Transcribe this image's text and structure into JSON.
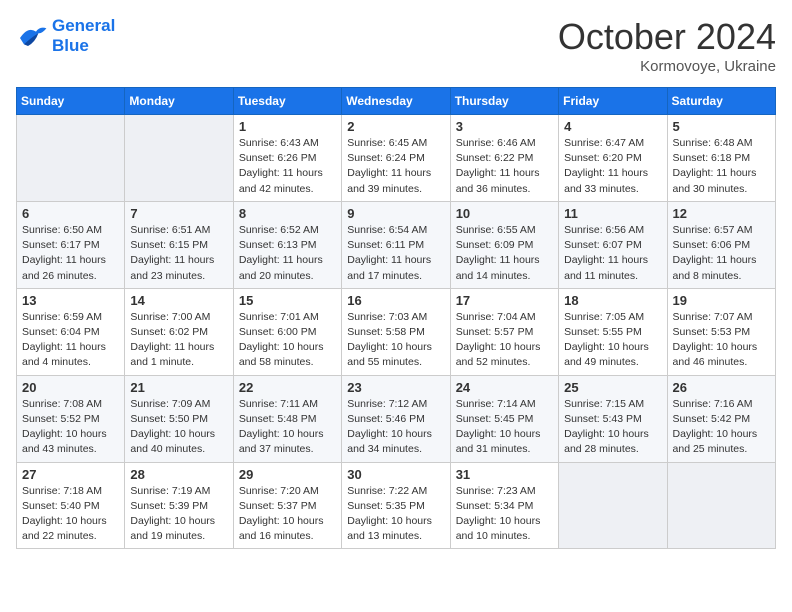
{
  "header": {
    "logo_line1": "General",
    "logo_line2": "Blue",
    "month": "October 2024",
    "location": "Kormovoye, Ukraine"
  },
  "weekdays": [
    "Sunday",
    "Monday",
    "Tuesday",
    "Wednesday",
    "Thursday",
    "Friday",
    "Saturday"
  ],
  "weeks": [
    [
      {
        "day": "",
        "sunrise": "",
        "sunset": "",
        "daylight": ""
      },
      {
        "day": "",
        "sunrise": "",
        "sunset": "",
        "daylight": ""
      },
      {
        "day": "1",
        "sunrise": "Sunrise: 6:43 AM",
        "sunset": "Sunset: 6:26 PM",
        "daylight": "Daylight: 11 hours and 42 minutes."
      },
      {
        "day": "2",
        "sunrise": "Sunrise: 6:45 AM",
        "sunset": "Sunset: 6:24 PM",
        "daylight": "Daylight: 11 hours and 39 minutes."
      },
      {
        "day": "3",
        "sunrise": "Sunrise: 6:46 AM",
        "sunset": "Sunset: 6:22 PM",
        "daylight": "Daylight: 11 hours and 36 minutes."
      },
      {
        "day": "4",
        "sunrise": "Sunrise: 6:47 AM",
        "sunset": "Sunset: 6:20 PM",
        "daylight": "Daylight: 11 hours and 33 minutes."
      },
      {
        "day": "5",
        "sunrise": "Sunrise: 6:48 AM",
        "sunset": "Sunset: 6:18 PM",
        "daylight": "Daylight: 11 hours and 30 minutes."
      }
    ],
    [
      {
        "day": "6",
        "sunrise": "Sunrise: 6:50 AM",
        "sunset": "Sunset: 6:17 PM",
        "daylight": "Daylight: 11 hours and 26 minutes."
      },
      {
        "day": "7",
        "sunrise": "Sunrise: 6:51 AM",
        "sunset": "Sunset: 6:15 PM",
        "daylight": "Daylight: 11 hours and 23 minutes."
      },
      {
        "day": "8",
        "sunrise": "Sunrise: 6:52 AM",
        "sunset": "Sunset: 6:13 PM",
        "daylight": "Daylight: 11 hours and 20 minutes."
      },
      {
        "day": "9",
        "sunrise": "Sunrise: 6:54 AM",
        "sunset": "Sunset: 6:11 PM",
        "daylight": "Daylight: 11 hours and 17 minutes."
      },
      {
        "day": "10",
        "sunrise": "Sunrise: 6:55 AM",
        "sunset": "Sunset: 6:09 PM",
        "daylight": "Daylight: 11 hours and 14 minutes."
      },
      {
        "day": "11",
        "sunrise": "Sunrise: 6:56 AM",
        "sunset": "Sunset: 6:07 PM",
        "daylight": "Daylight: 11 hours and 11 minutes."
      },
      {
        "day": "12",
        "sunrise": "Sunrise: 6:57 AM",
        "sunset": "Sunset: 6:06 PM",
        "daylight": "Daylight: 11 hours and 8 minutes."
      }
    ],
    [
      {
        "day": "13",
        "sunrise": "Sunrise: 6:59 AM",
        "sunset": "Sunset: 6:04 PM",
        "daylight": "Daylight: 11 hours and 4 minutes."
      },
      {
        "day": "14",
        "sunrise": "Sunrise: 7:00 AM",
        "sunset": "Sunset: 6:02 PM",
        "daylight": "Daylight: 11 hours and 1 minute."
      },
      {
        "day": "15",
        "sunrise": "Sunrise: 7:01 AM",
        "sunset": "Sunset: 6:00 PM",
        "daylight": "Daylight: 10 hours and 58 minutes."
      },
      {
        "day": "16",
        "sunrise": "Sunrise: 7:03 AM",
        "sunset": "Sunset: 5:58 PM",
        "daylight": "Daylight: 10 hours and 55 minutes."
      },
      {
        "day": "17",
        "sunrise": "Sunrise: 7:04 AM",
        "sunset": "Sunset: 5:57 PM",
        "daylight": "Daylight: 10 hours and 52 minutes."
      },
      {
        "day": "18",
        "sunrise": "Sunrise: 7:05 AM",
        "sunset": "Sunset: 5:55 PM",
        "daylight": "Daylight: 10 hours and 49 minutes."
      },
      {
        "day": "19",
        "sunrise": "Sunrise: 7:07 AM",
        "sunset": "Sunset: 5:53 PM",
        "daylight": "Daylight: 10 hours and 46 minutes."
      }
    ],
    [
      {
        "day": "20",
        "sunrise": "Sunrise: 7:08 AM",
        "sunset": "Sunset: 5:52 PM",
        "daylight": "Daylight: 10 hours and 43 minutes."
      },
      {
        "day": "21",
        "sunrise": "Sunrise: 7:09 AM",
        "sunset": "Sunset: 5:50 PM",
        "daylight": "Daylight: 10 hours and 40 minutes."
      },
      {
        "day": "22",
        "sunrise": "Sunrise: 7:11 AM",
        "sunset": "Sunset: 5:48 PM",
        "daylight": "Daylight: 10 hours and 37 minutes."
      },
      {
        "day": "23",
        "sunrise": "Sunrise: 7:12 AM",
        "sunset": "Sunset: 5:46 PM",
        "daylight": "Daylight: 10 hours and 34 minutes."
      },
      {
        "day": "24",
        "sunrise": "Sunrise: 7:14 AM",
        "sunset": "Sunset: 5:45 PM",
        "daylight": "Daylight: 10 hours and 31 minutes."
      },
      {
        "day": "25",
        "sunrise": "Sunrise: 7:15 AM",
        "sunset": "Sunset: 5:43 PM",
        "daylight": "Daylight: 10 hours and 28 minutes."
      },
      {
        "day": "26",
        "sunrise": "Sunrise: 7:16 AM",
        "sunset": "Sunset: 5:42 PM",
        "daylight": "Daylight: 10 hours and 25 minutes."
      }
    ],
    [
      {
        "day": "27",
        "sunrise": "Sunrise: 7:18 AM",
        "sunset": "Sunset: 5:40 PM",
        "daylight": "Daylight: 10 hours and 22 minutes."
      },
      {
        "day": "28",
        "sunrise": "Sunrise: 7:19 AM",
        "sunset": "Sunset: 5:39 PM",
        "daylight": "Daylight: 10 hours and 19 minutes."
      },
      {
        "day": "29",
        "sunrise": "Sunrise: 7:20 AM",
        "sunset": "Sunset: 5:37 PM",
        "daylight": "Daylight: 10 hours and 16 minutes."
      },
      {
        "day": "30",
        "sunrise": "Sunrise: 7:22 AM",
        "sunset": "Sunset: 5:35 PM",
        "daylight": "Daylight: 10 hours and 13 minutes."
      },
      {
        "day": "31",
        "sunrise": "Sunrise: 7:23 AM",
        "sunset": "Sunset: 5:34 PM",
        "daylight": "Daylight: 10 hours and 10 minutes."
      },
      {
        "day": "",
        "sunrise": "",
        "sunset": "",
        "daylight": ""
      },
      {
        "day": "",
        "sunrise": "",
        "sunset": "",
        "daylight": ""
      }
    ]
  ]
}
